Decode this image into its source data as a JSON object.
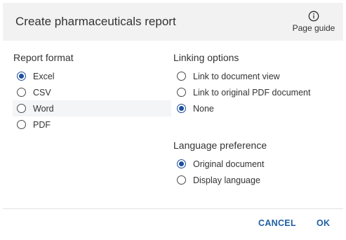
{
  "dialog": {
    "title": "Create pharmaceuticals report",
    "page_guide": {
      "label": "Page guide",
      "icon": "info-icon"
    }
  },
  "report_format": {
    "title": "Report format",
    "options": [
      {
        "label": "Excel",
        "selected": true
      },
      {
        "label": "CSV",
        "selected": false
      },
      {
        "label": "Word",
        "selected": false
      },
      {
        "label": "PDF",
        "selected": false
      }
    ]
  },
  "linking_options": {
    "title": "Linking options",
    "options": [
      {
        "label": "Link to document view",
        "selected": false
      },
      {
        "label": "Link to original PDF document",
        "selected": false
      },
      {
        "label": "None",
        "selected": true
      }
    ]
  },
  "language_preference": {
    "title": "Language preference",
    "options": [
      {
        "label": "Original document",
        "selected": true
      },
      {
        "label": "Display language",
        "selected": false
      }
    ]
  },
  "actions": {
    "cancel": "CANCEL",
    "ok": "OK"
  },
  "colors": {
    "accent": "#1f4e9c",
    "button_text": "#1f5fa3",
    "header_bg": "#f2f2f2"
  }
}
